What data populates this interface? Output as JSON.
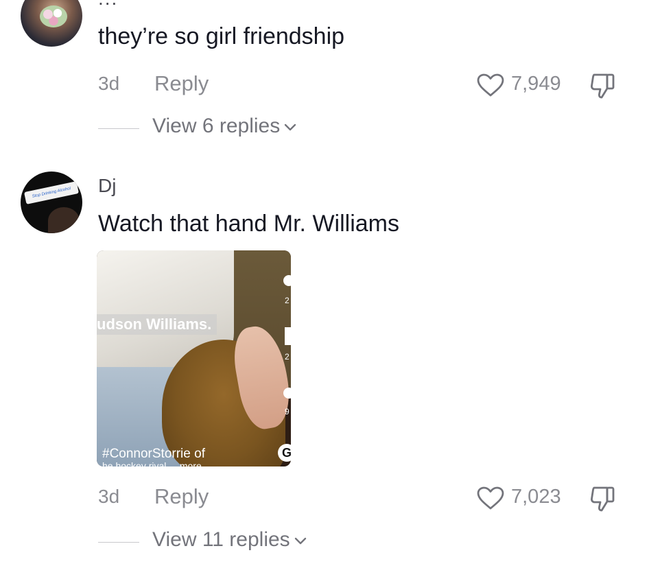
{
  "comments": [
    {
      "username": "...",
      "text": "they’re so girl friendship",
      "time": "3d",
      "reply_label": "Reply",
      "likes": "7,949",
      "view_replies": "View 6 replies"
    },
    {
      "username": "Dj",
      "text": "Watch that hand Mr. Williams",
      "avatar_sticker_text": "Stop Drinking Alcohol",
      "media": {
        "overlay_name": "udson Williams.",
        "caption": "#ConnorStorrie of",
        "caption_cut": "he hockey rival ... more",
        "side_nums": [
          "2",
          "2",
          "9"
        ],
        "badge": "G"
      },
      "time": "3d",
      "reply_label": "Reply",
      "likes": "7,023",
      "view_replies": "View 11 replies"
    }
  ],
  "icons": {
    "like": "heart-outline-icon",
    "dislike": "thumbs-down-icon",
    "expand": "chevron-down-icon"
  },
  "colors": {
    "text_primary": "#161823",
    "text_secondary": "#8a8b91",
    "view_replies": "#73747b"
  }
}
